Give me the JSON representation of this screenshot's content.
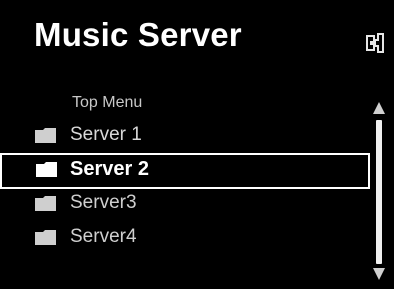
{
  "header": {
    "title": "Music Server",
    "icon": "network-input-icon"
  },
  "menu": {
    "parent_label": "Top Menu",
    "items": [
      {
        "label": "Server 1",
        "icon": "folder-icon",
        "selected": false
      },
      {
        "label": "Server 2",
        "icon": "folder-icon",
        "selected": true
      },
      {
        "label": "Server3",
        "icon": "folder-icon",
        "selected": false
      },
      {
        "label": "Server4",
        "icon": "folder-icon",
        "selected": false
      }
    ]
  },
  "scrollbar": {
    "position_fraction": 0.0
  },
  "colors": {
    "background": "#000000",
    "text": "#ffffff",
    "selection_border": "#ffffff"
  }
}
